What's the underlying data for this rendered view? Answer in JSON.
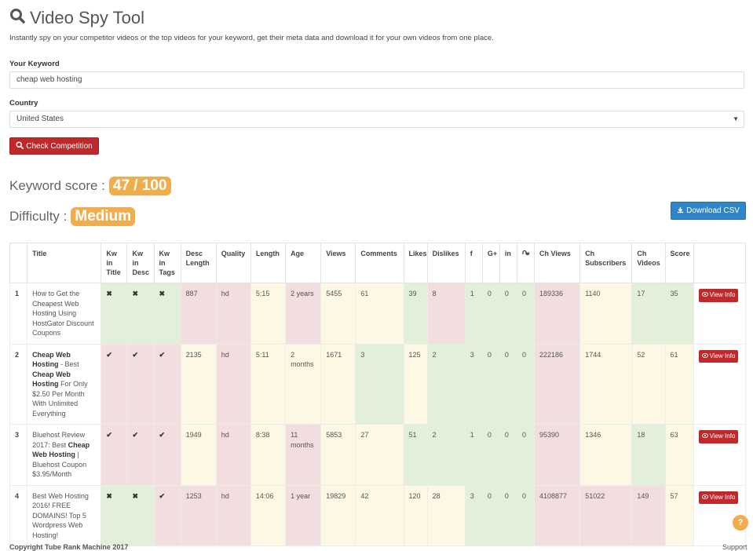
{
  "header": {
    "title": "Video Spy Tool",
    "subtitle": "Instantly spy on your competitor videos or the top videos for your keyword, get their meta data and download it for your own videos from one place."
  },
  "form": {
    "keyword_label": "Your Keyword",
    "keyword_value": "cheap web hosting",
    "country_label": "Country",
    "country_value": "United States",
    "check_button": "Check Competition"
  },
  "results": {
    "keyword_score_label": "Keyword score :",
    "keyword_score_value": "47 / 100",
    "difficulty_label": "Difficulty :",
    "difficulty_value": "Medium",
    "download_button": "Download CSV"
  },
  "table": {
    "headers": [
      "",
      "Title",
      "Kw in Title",
      "Kw in Desc",
      "Kw in Tags",
      "Desc Length",
      "Quality",
      "Length",
      "Age",
      "Views",
      "Comments",
      "Likes",
      "Dislikes",
      "f",
      "G+",
      "in",
      "",
      "Ch Views",
      "Ch Subscribers",
      "Ch Videos",
      "Score",
      ""
    ],
    "view_label": "View Info",
    "rows": [
      {
        "num": "1",
        "title_parts": [
          {
            "t": "How to Get the Cheapest Web Hosting Using HostGator Discount Coupons",
            "b": false
          }
        ],
        "kw_title": "✖",
        "kw_desc": "✖",
        "kw_tags": "✖",
        "desc_length": "887",
        "quality": "hd",
        "length": "5:15",
        "age": "2 years",
        "views": "5455",
        "comments": "61",
        "likes": "39",
        "dislikes": "8",
        "fb": "1",
        "gplus": "0",
        "li": "0",
        "su": "0",
        "ch_views": "189336",
        "ch_subs": "1140",
        "ch_videos": "17",
        "score": "35"
      },
      {
        "num": "2",
        "title_parts": [
          {
            "t": "Cheap Web Hosting",
            "b": true
          },
          {
            "t": " - Best ",
            "b": false
          },
          {
            "t": "Cheap Web Hosting",
            "b": true
          },
          {
            "t": " For Only $2.50 Per Month With Unlimited Everything",
            "b": false
          }
        ],
        "kw_title": "✔",
        "kw_desc": "✔",
        "kw_tags": "✔",
        "desc_length": "2135",
        "quality": "hd",
        "length": "5:11",
        "age": "2 months",
        "views": "1671",
        "comments": "3",
        "likes": "125",
        "dislikes": "2",
        "fb": "3",
        "gplus": "0",
        "li": "0",
        "su": "0",
        "ch_views": "222186",
        "ch_subs": "1744",
        "ch_videos": "52",
        "score": "61"
      },
      {
        "num": "3",
        "title_parts": [
          {
            "t": "Bluehost Review 2017: Best ",
            "b": false
          },
          {
            "t": "Cheap Web Hosting",
            "b": true
          },
          {
            "t": " | Bluehost Coupon $3.95/Month",
            "b": false
          }
        ],
        "kw_title": "✔",
        "kw_desc": "✔",
        "kw_tags": "✔",
        "desc_length": "1949",
        "quality": "hd",
        "length": "8:38",
        "age": "11 months",
        "views": "5853",
        "comments": "27",
        "likes": "51",
        "dislikes": "2",
        "fb": "1",
        "gplus": "0",
        "li": "0",
        "su": "0",
        "ch_views": "95390",
        "ch_subs": "1346",
        "ch_videos": "18",
        "score": "63"
      },
      {
        "num": "4",
        "title_parts": [
          {
            "t": "Best Web Hosting 2016! FREE DOMAINS! Top 5 Wordpress Web Hosting!",
            "b": false
          }
        ],
        "kw_title": "✖",
        "kw_desc": "✖",
        "kw_tags": "✔",
        "desc_length": "1253",
        "quality": "hd",
        "length": "14:06",
        "age": "1 year",
        "views": "19829",
        "comments": "42",
        "likes": "120",
        "dislikes": "28",
        "fb": "3",
        "gplus": "0",
        "li": "0",
        "su": "0",
        "ch_views": "4108877",
        "ch_subs": "51022",
        "ch_videos": "149",
        "score": "57"
      }
    ]
  },
  "footer": {
    "copyright": "Copyright Tube Rank Machine 2017",
    "support": "Support",
    "help_glyph": "?"
  },
  "colors": {
    "red_button": "#c0282b",
    "blue_button": "#2e86c9",
    "badge": "#f0ad4e",
    "cell_green": "#e2f0d9",
    "cell_red": "#f2dede",
    "cell_yellow": "#fcf8e3"
  }
}
